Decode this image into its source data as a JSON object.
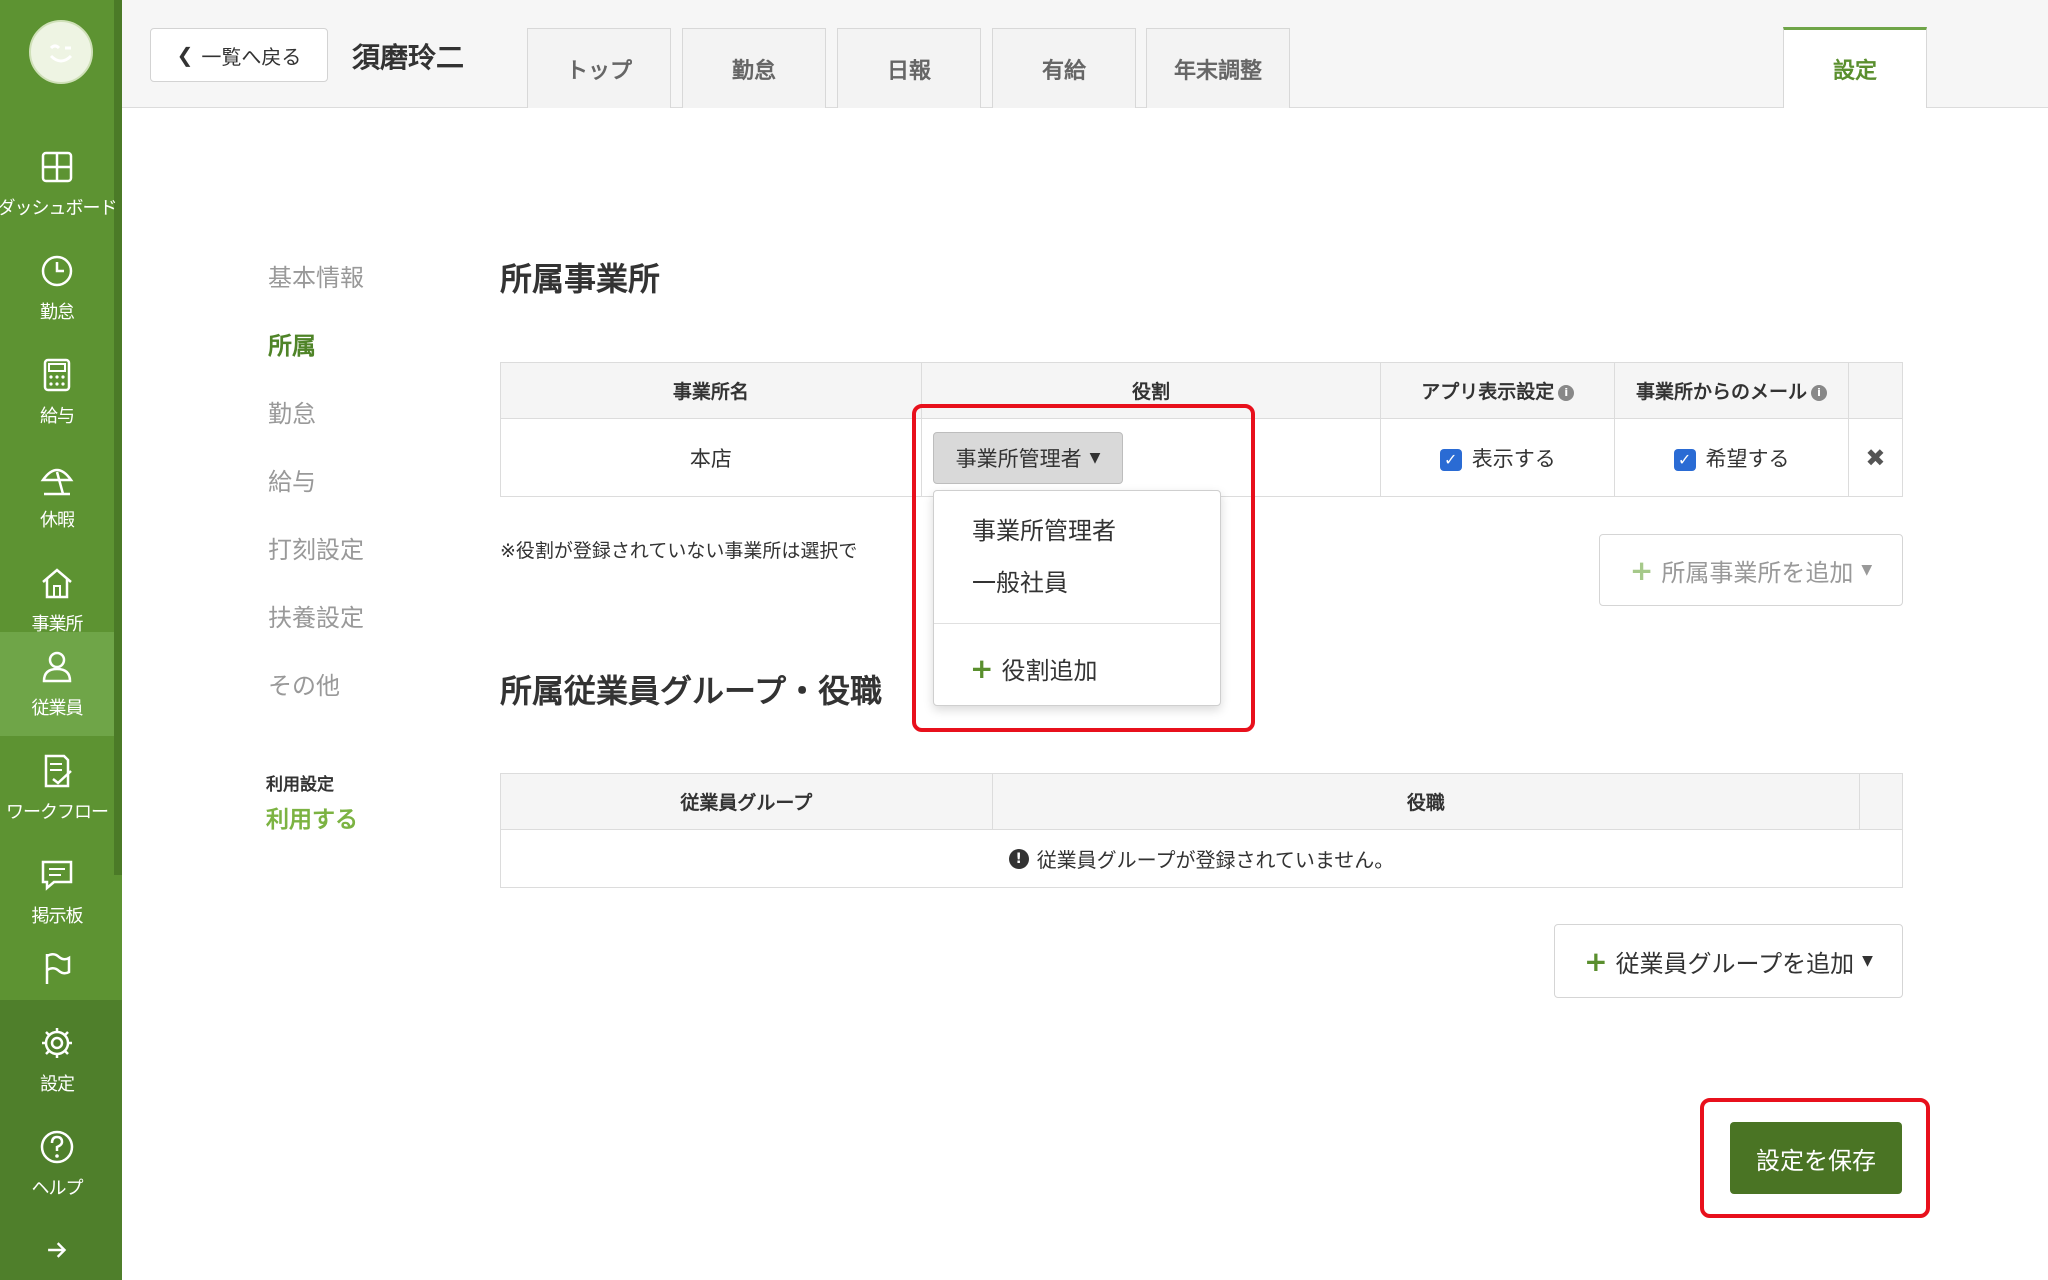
{
  "sidebar": {
    "items": [
      {
        "label": "ダッシュボード",
        "icon": "dashboard-icon"
      },
      {
        "label": "勤怠",
        "icon": "clock-icon"
      },
      {
        "label": "給与",
        "icon": "calculator-icon"
      },
      {
        "label": "休暇",
        "icon": "beach-umbrella-icon"
      },
      {
        "label": "事業所",
        "icon": "home-icon"
      },
      {
        "label": "従業員",
        "icon": "person-icon"
      },
      {
        "label": "ワークフロー",
        "icon": "workflow-check-icon"
      },
      {
        "label": "掲示板",
        "icon": "message-board-icon"
      },
      {
        "label": "",
        "icon": "flag-icon"
      },
      {
        "label": "設定",
        "icon": "gear-icon"
      },
      {
        "label": "ヘルプ",
        "icon": "help-icon"
      }
    ],
    "active": "従業員"
  },
  "header": {
    "back_label": "一覧へ戻る",
    "employee_name": "須磨玲二",
    "tabs": [
      "トップ",
      "勤怠",
      "日報",
      "有給",
      "年末調整"
    ],
    "settings_tab": "設定"
  },
  "subnav": {
    "items": [
      "基本情報",
      "所属",
      "勤怠",
      "給与",
      "打刻設定",
      "扶養設定",
      "その他"
    ],
    "active": "所属",
    "usage_label": "利用設定",
    "usage_value": "利用する"
  },
  "offices": {
    "title": "所属事業所",
    "columns": [
      "事業所名",
      "役割",
      "アプリ表示設定",
      "事業所からのメール"
    ],
    "row": {
      "office_name": "本店",
      "role": "事業所管理者",
      "app_display": "表示する",
      "mail": "希望する"
    },
    "note": "※役割が登録されていない事業所は選択で",
    "add_button": "所属事業所を追加"
  },
  "role_dropdown": {
    "options": [
      "事業所管理者",
      "一般社員"
    ],
    "add_label": "役割追加"
  },
  "groups": {
    "title": "所属従業員グループ・役職",
    "columns": [
      "従業員グループ",
      "役職"
    ],
    "empty_message": "従業員グループが登録されていません。",
    "add_button": "従業員グループを追加"
  },
  "save_button": "設定を保存",
  "colors": {
    "sidebar": "#5d9332",
    "accent": "#6fa548",
    "save": "#4a7424",
    "highlight": "#e8101c",
    "checkbox": "#2a6bd4"
  }
}
